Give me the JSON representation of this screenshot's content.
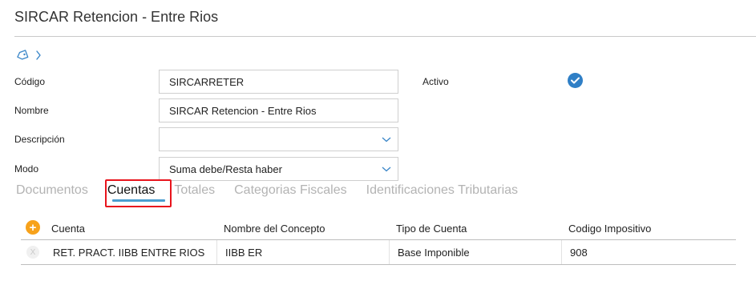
{
  "page": {
    "title": "SIRCAR Retencion - Entre Rios"
  },
  "breadcrumb": {
    "icon": "tag-icon",
    "chevron": "chevron-right-icon"
  },
  "form": {
    "codigo": {
      "label": "Código",
      "value": "SIRCARRETER"
    },
    "nombre": {
      "label": "Nombre",
      "value": "SIRCAR Retencion - Entre Rios"
    },
    "descripcion": {
      "label": "Descripción",
      "value": ""
    },
    "modo": {
      "label": "Modo",
      "value": "Suma debe/Resta haber"
    },
    "activo": {
      "label": "Activo",
      "checked": true
    }
  },
  "tabs": [
    {
      "label": "Documentos",
      "active": false
    },
    {
      "label": "Cuentas",
      "active": true
    },
    {
      "label": "Totales",
      "active": false
    },
    {
      "label": "Categorias Fiscales",
      "active": false
    },
    {
      "label": "Identificaciones Tributarias",
      "active": false
    }
  ],
  "grid": {
    "add_label": "+",
    "delete_label": "X",
    "columns": [
      "Cuenta",
      "Nombre del Concepto",
      "Tipo de Cuenta",
      "Codigo Impositivo"
    ],
    "rows": [
      [
        "RET. PRACT. IIBB ENTRE RIOS",
        "IIBB ER",
        "Base Imponible",
        "908"
      ]
    ]
  },
  "colors": {
    "accent": "#2f7fc6",
    "highlight": "#e8141c",
    "add_button": "#f7a21b",
    "tab_underline": "#4a9ed0"
  }
}
